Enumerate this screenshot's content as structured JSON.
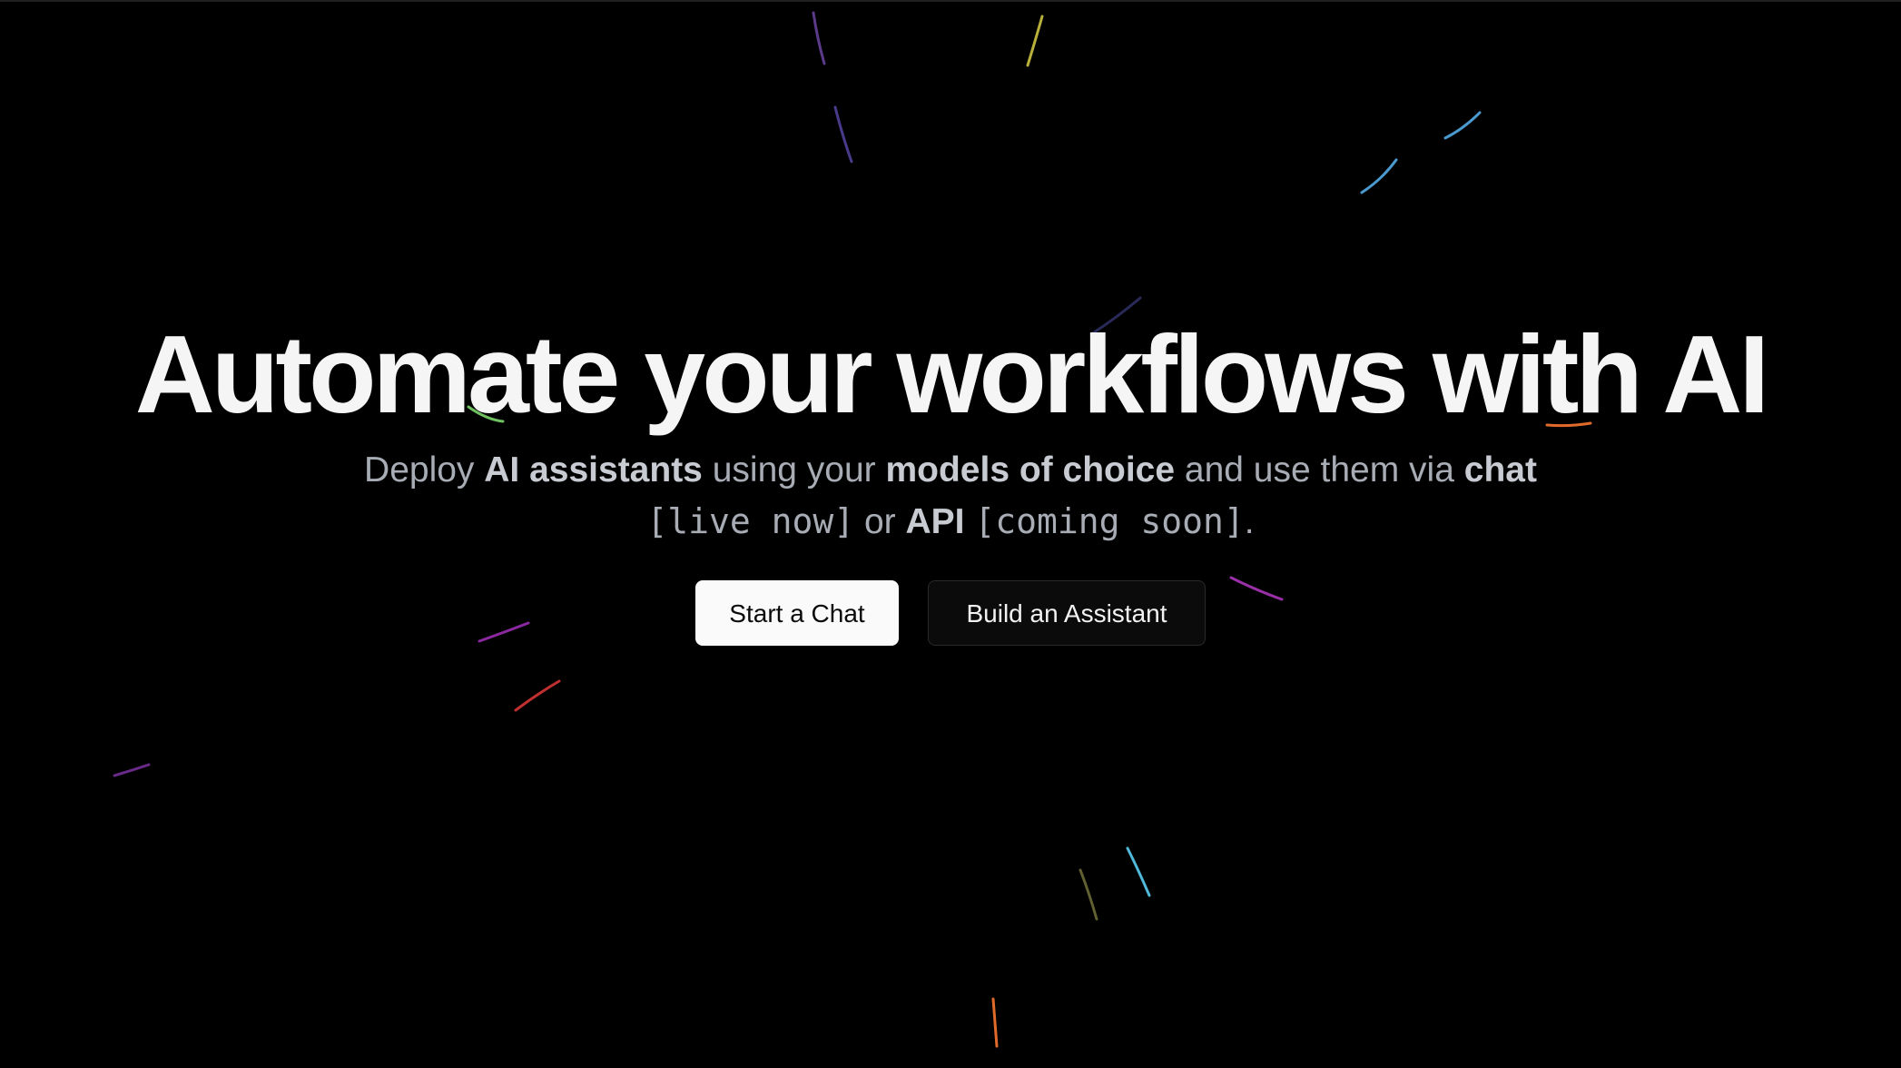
{
  "hero": {
    "headline": "Automate your workflows with AI",
    "subtitle": {
      "part1": "Deploy ",
      "bold1": "AI assistants",
      "part2": " using your ",
      "bold2": "models of choice",
      "part3": " and use them via ",
      "bold3": "chat",
      "mono1": "[live now]",
      "part4": " or ",
      "bold4": "API",
      "mono2": "[coming soon]",
      "part5": "."
    }
  },
  "actions": {
    "start_chat_label": "Start a Chat",
    "build_assistant_label": "Build an Assistant"
  },
  "colors": {
    "background": "#000000",
    "headline": "#f5f5f5",
    "subtitle": "#a8adb5",
    "subtitle_bold": "#c8ccd2",
    "primary_button_bg": "#fafafa",
    "secondary_button_bg": "#0b0b0c",
    "streak_purple": "#5b3a8a",
    "streak_yellow": "#b8b03a",
    "streak_blue": "#4a9ad0",
    "streak_green": "#6fc060",
    "streak_orange": "#e06a2a",
    "streak_magenta": "#9a30a8",
    "streak_red": "#c03030",
    "streak_cyan": "#50b8d8",
    "streak_olive": "#606030"
  }
}
